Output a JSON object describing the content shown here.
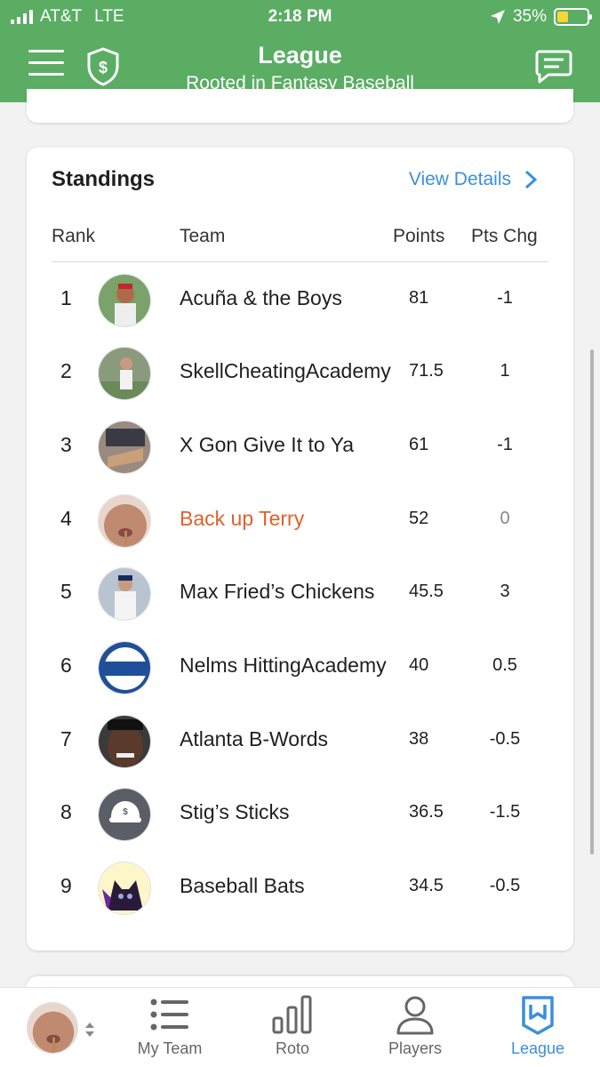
{
  "status_bar": {
    "carrier": "AT&T",
    "network": "LTE",
    "time": "2:18 PM",
    "battery": "35%"
  },
  "nav": {
    "title": "League",
    "subtitle": "Rooted in Fantasy Baseball"
  },
  "standings": {
    "title": "Standings",
    "view_details": "View Details",
    "columns": {
      "rank": "Rank",
      "team": "Team",
      "points": "Points",
      "pts_chg": "Pts Chg"
    },
    "rows": [
      {
        "rank": "1",
        "team": "Acuña & the Boys",
        "points": "81",
        "pts_chg": "-1"
      },
      {
        "rank": "2",
        "team": "SkellCheatingAcademy",
        "points": "71.5",
        "pts_chg": "1"
      },
      {
        "rank": "3",
        "team": "X Gon Give It to Ya",
        "points": "61",
        "pts_chg": "-1"
      },
      {
        "rank": "4",
        "team": "Back up Terry",
        "points": "52",
        "pts_chg": "0"
      },
      {
        "rank": "5",
        "team": "Max Fried’s Chickens",
        "points": "45.5",
        "pts_chg": "3"
      },
      {
        "rank": "6",
        "team": "Nelms HittingAcademy",
        "points": "40",
        "pts_chg": "0.5"
      },
      {
        "rank": "7",
        "team": "Atlanta B-Words",
        "points": "38",
        "pts_chg": "-0.5"
      },
      {
        "rank": "8",
        "team": "Stig’s Sticks",
        "points": "36.5",
        "pts_chg": "-1.5"
      },
      {
        "rank": "9",
        "team": "Baseball Bats",
        "points": "34.5",
        "pts_chg": "-0.5"
      }
    ]
  },
  "tabs": {
    "my_team": "My Team",
    "roto": "Roto",
    "players": "Players",
    "league": "League"
  },
  "colors": {
    "header_green": "#5aad63",
    "accent_blue": "#3b8fdc",
    "highlight_orange": "#e0612a"
  }
}
